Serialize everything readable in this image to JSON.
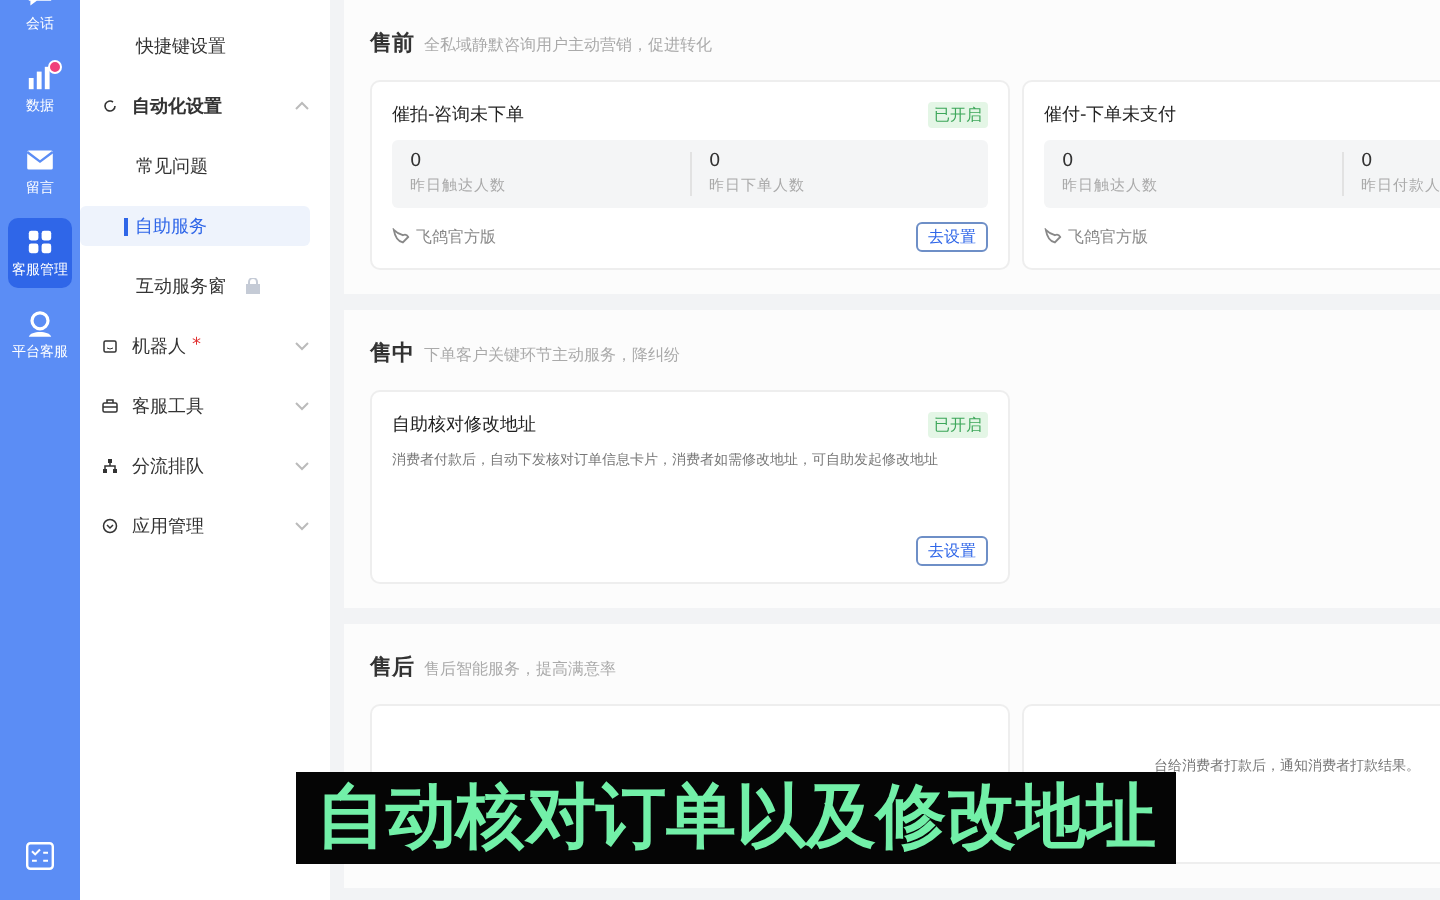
{
  "rail": {
    "items": [
      {
        "label": "会话",
        "selected": false,
        "badge": false
      },
      {
        "label": "数据",
        "selected": false,
        "badge": true
      },
      {
        "label": "留言",
        "selected": false,
        "badge": false
      },
      {
        "label": "客服管理",
        "selected": true,
        "badge": false
      },
      {
        "label": "平台客服",
        "selected": false,
        "badge": false
      }
    ]
  },
  "nav": {
    "items": [
      {
        "label": "快捷键设置",
        "selected": false
      },
      {
        "label": "自动化设置",
        "expanded": true,
        "children": [
          {
            "label": "常见问题",
            "selected": false
          },
          {
            "label": "自助服务",
            "selected": true
          },
          {
            "label": "互动服务窗",
            "selected": false,
            "locked": true
          }
        ]
      },
      {
        "label": "机器人",
        "expanded": false,
        "required_mark": "*"
      },
      {
        "label": "客服工具",
        "expanded": false
      },
      {
        "label": "分流排队",
        "expanded": false
      },
      {
        "label": "应用管理",
        "expanded": false
      }
    ]
  },
  "sections": [
    {
      "title": "售前",
      "subtitle": "全私域静默咨询用户主动营销，促进转化",
      "cards": [
        {
          "title": "催拍-咨询未下单",
          "status": "已开启",
          "stats": [
            {
              "value": "0",
              "label": "昨日触达人数"
            },
            {
              "value": "0",
              "label": "昨日下单人数"
            }
          ],
          "footer": "飞鸽官方版",
          "button": "去设置"
        },
        {
          "title": "催付-下单未支付",
          "stats": [
            {
              "value": "0",
              "label": "昨日触达人数"
            },
            {
              "value": "0",
              "label": "昨日付款人"
            }
          ],
          "footer": "飞鸽官方版"
        }
      ]
    },
    {
      "title": "售中",
      "subtitle": "下单客户关键环节主动服务，降纠纷",
      "cards": [
        {
          "title": "自助核对修改地址",
          "status": "已开启",
          "description": "消费者付款后，自动下发核对订单信息卡片，消费者如需修改地址，可自助发起修改地址",
          "button": "去设置"
        }
      ]
    },
    {
      "title": "售后",
      "subtitle": "售后智能服务，提高满意率",
      "cards": [
        {
          "kind": "blank"
        },
        {
          "kind": "text",
          "description": "台给消费者打款后，通知消费者打款结果。"
        }
      ]
    }
  ],
  "subtitle_caption": "自动核对订单以及修改地址"
}
